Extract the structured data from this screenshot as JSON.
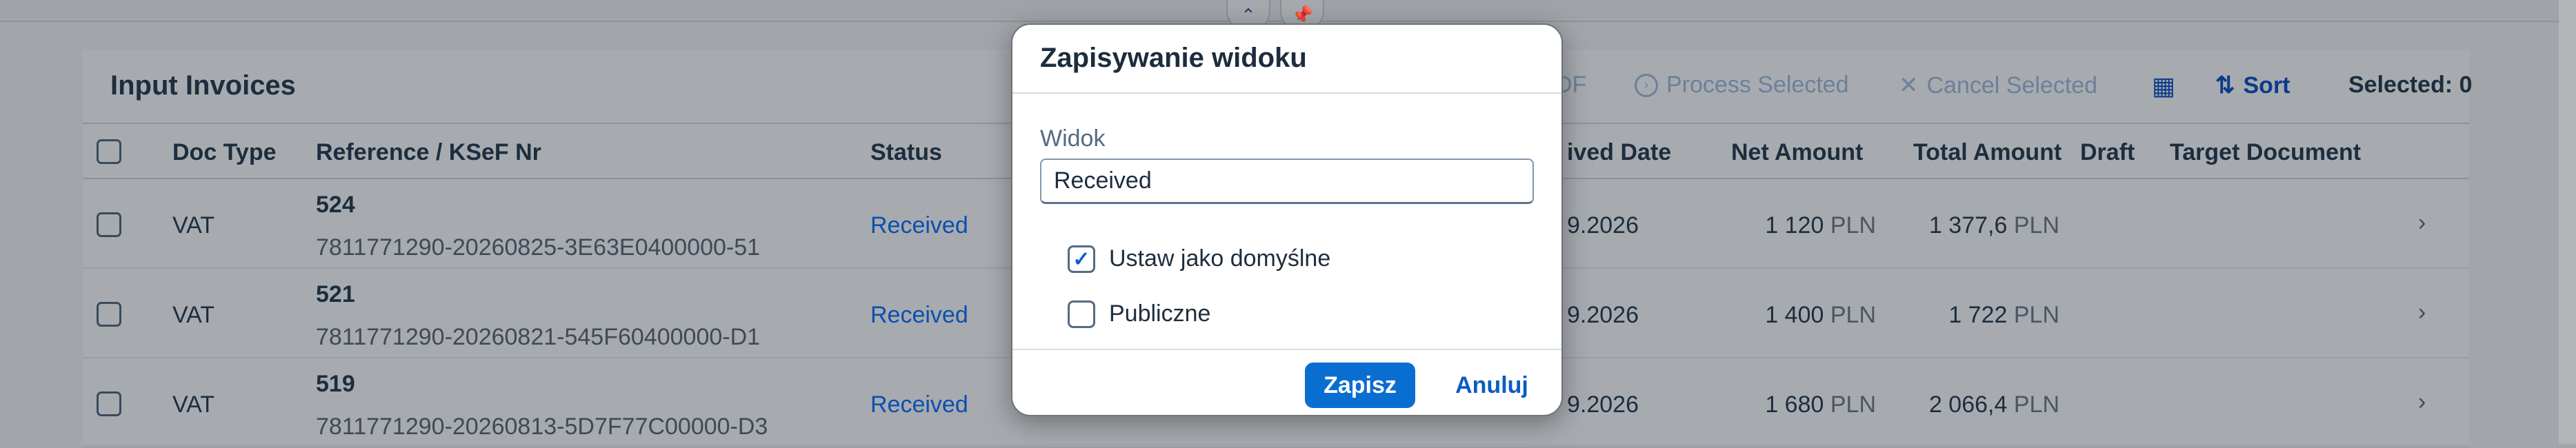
{
  "panel": {
    "title": "Input Invoices",
    "toolbar": {
      "pdf_partial": "DF",
      "process_label": "Process Selected",
      "cancel_label": "Cancel Selected",
      "sort_label": "Sort",
      "selected_label": "Selected: 0"
    },
    "columns": {
      "doc_type": "Doc Type",
      "reference": "Reference / KSeF Nr",
      "status": "Status",
      "received_date_partial": "ived Date",
      "net_amount": "Net Amount",
      "total_amount": "Total Amount",
      "draft": "Draft",
      "target_document": "Target Document"
    },
    "rows": [
      {
        "doc_type": "VAT",
        "number": "524",
        "ksef": "7811771290-20260825-3E63E0400000-51",
        "status": "Received",
        "date_partial": "9.2026",
        "net": "1 120",
        "total": "1 377,6",
        "currency": "PLN"
      },
      {
        "doc_type": "VAT",
        "number": "521",
        "ksef": "7811771290-20260821-545F60400000-D1",
        "status": "Received",
        "date_partial": "9.2026",
        "net": "1 400",
        "total": "1 722",
        "currency": "PLN"
      },
      {
        "doc_type": "VAT",
        "number": "519",
        "ksef": "7811771290-20260813-5D7F77C00000-D3",
        "status": "Received",
        "date_partial": "9.2026",
        "net": "1 680",
        "total": "2 066,4",
        "currency": "PLN"
      }
    ]
  },
  "dialog": {
    "title": "Zapisywanie widoku",
    "field_label": "Widok",
    "field_value": "Received",
    "set_default_label": "Ustaw jako domyślne",
    "set_default_checked": true,
    "public_label": "Publiczne",
    "public_checked": false,
    "save_label": "Zapisz",
    "cancel_label": "Anuluj"
  },
  "icons": {
    "collapse": "chevron-up-icon",
    "pin": "pin-icon",
    "process": "play-circle-icon",
    "cancel": "close-icon",
    "columns": "table-settings-icon",
    "sort": "sort-icon",
    "row_nav": "chevron-right-icon"
  },
  "colors": {
    "primary": "#0a6ed1",
    "link": "#0b4fb0",
    "overlay": "#a7abaf"
  }
}
